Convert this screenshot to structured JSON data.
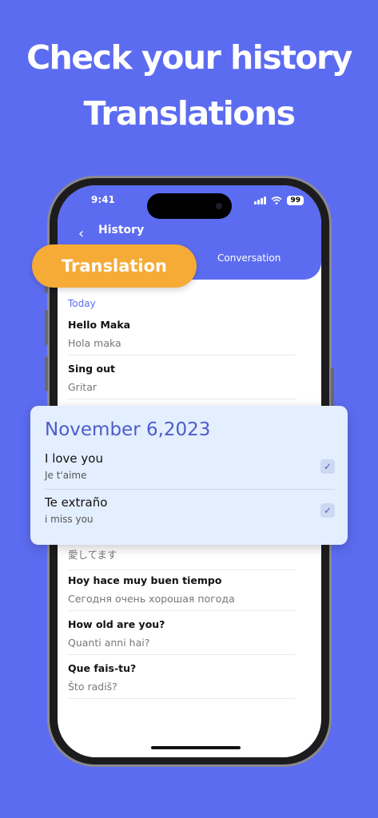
{
  "headline": {
    "line1": "Check your history",
    "line2": "Translations"
  },
  "status_bar": {
    "time": "9:41",
    "battery": "99"
  },
  "nav": {
    "back_icon": "chevron-left-icon",
    "title": "History"
  },
  "tabs": {
    "translation": "Translation",
    "conversation": "Conversation"
  },
  "history": {
    "section": "Today",
    "items": [
      {
        "source": "Hello Maka",
        "target": "Hola maka"
      },
      {
        "source": "Sing out",
        "target": "Gritar"
      },
      {
        "source": "",
        "target": "愛してます"
      },
      {
        "source": "Hoy hace muy buen tiempo",
        "target": "Сегодня очень хорошая погода"
      },
      {
        "source": "How old are you?",
        "target": "Quanti anni hai?"
      },
      {
        "source": "Que fais-tu?",
        "target": "Što radiš?"
      }
    ]
  },
  "card": {
    "date": "November 6,2023",
    "items": [
      {
        "source": "I love you",
        "target": "Je t'aime",
        "checked": true
      },
      {
        "source": "Te extraño",
        "target": "i miss you",
        "checked": true
      }
    ]
  },
  "colors": {
    "background": "#5c6cf0",
    "accent": "#f6ab36",
    "card": "#e3eeff"
  }
}
